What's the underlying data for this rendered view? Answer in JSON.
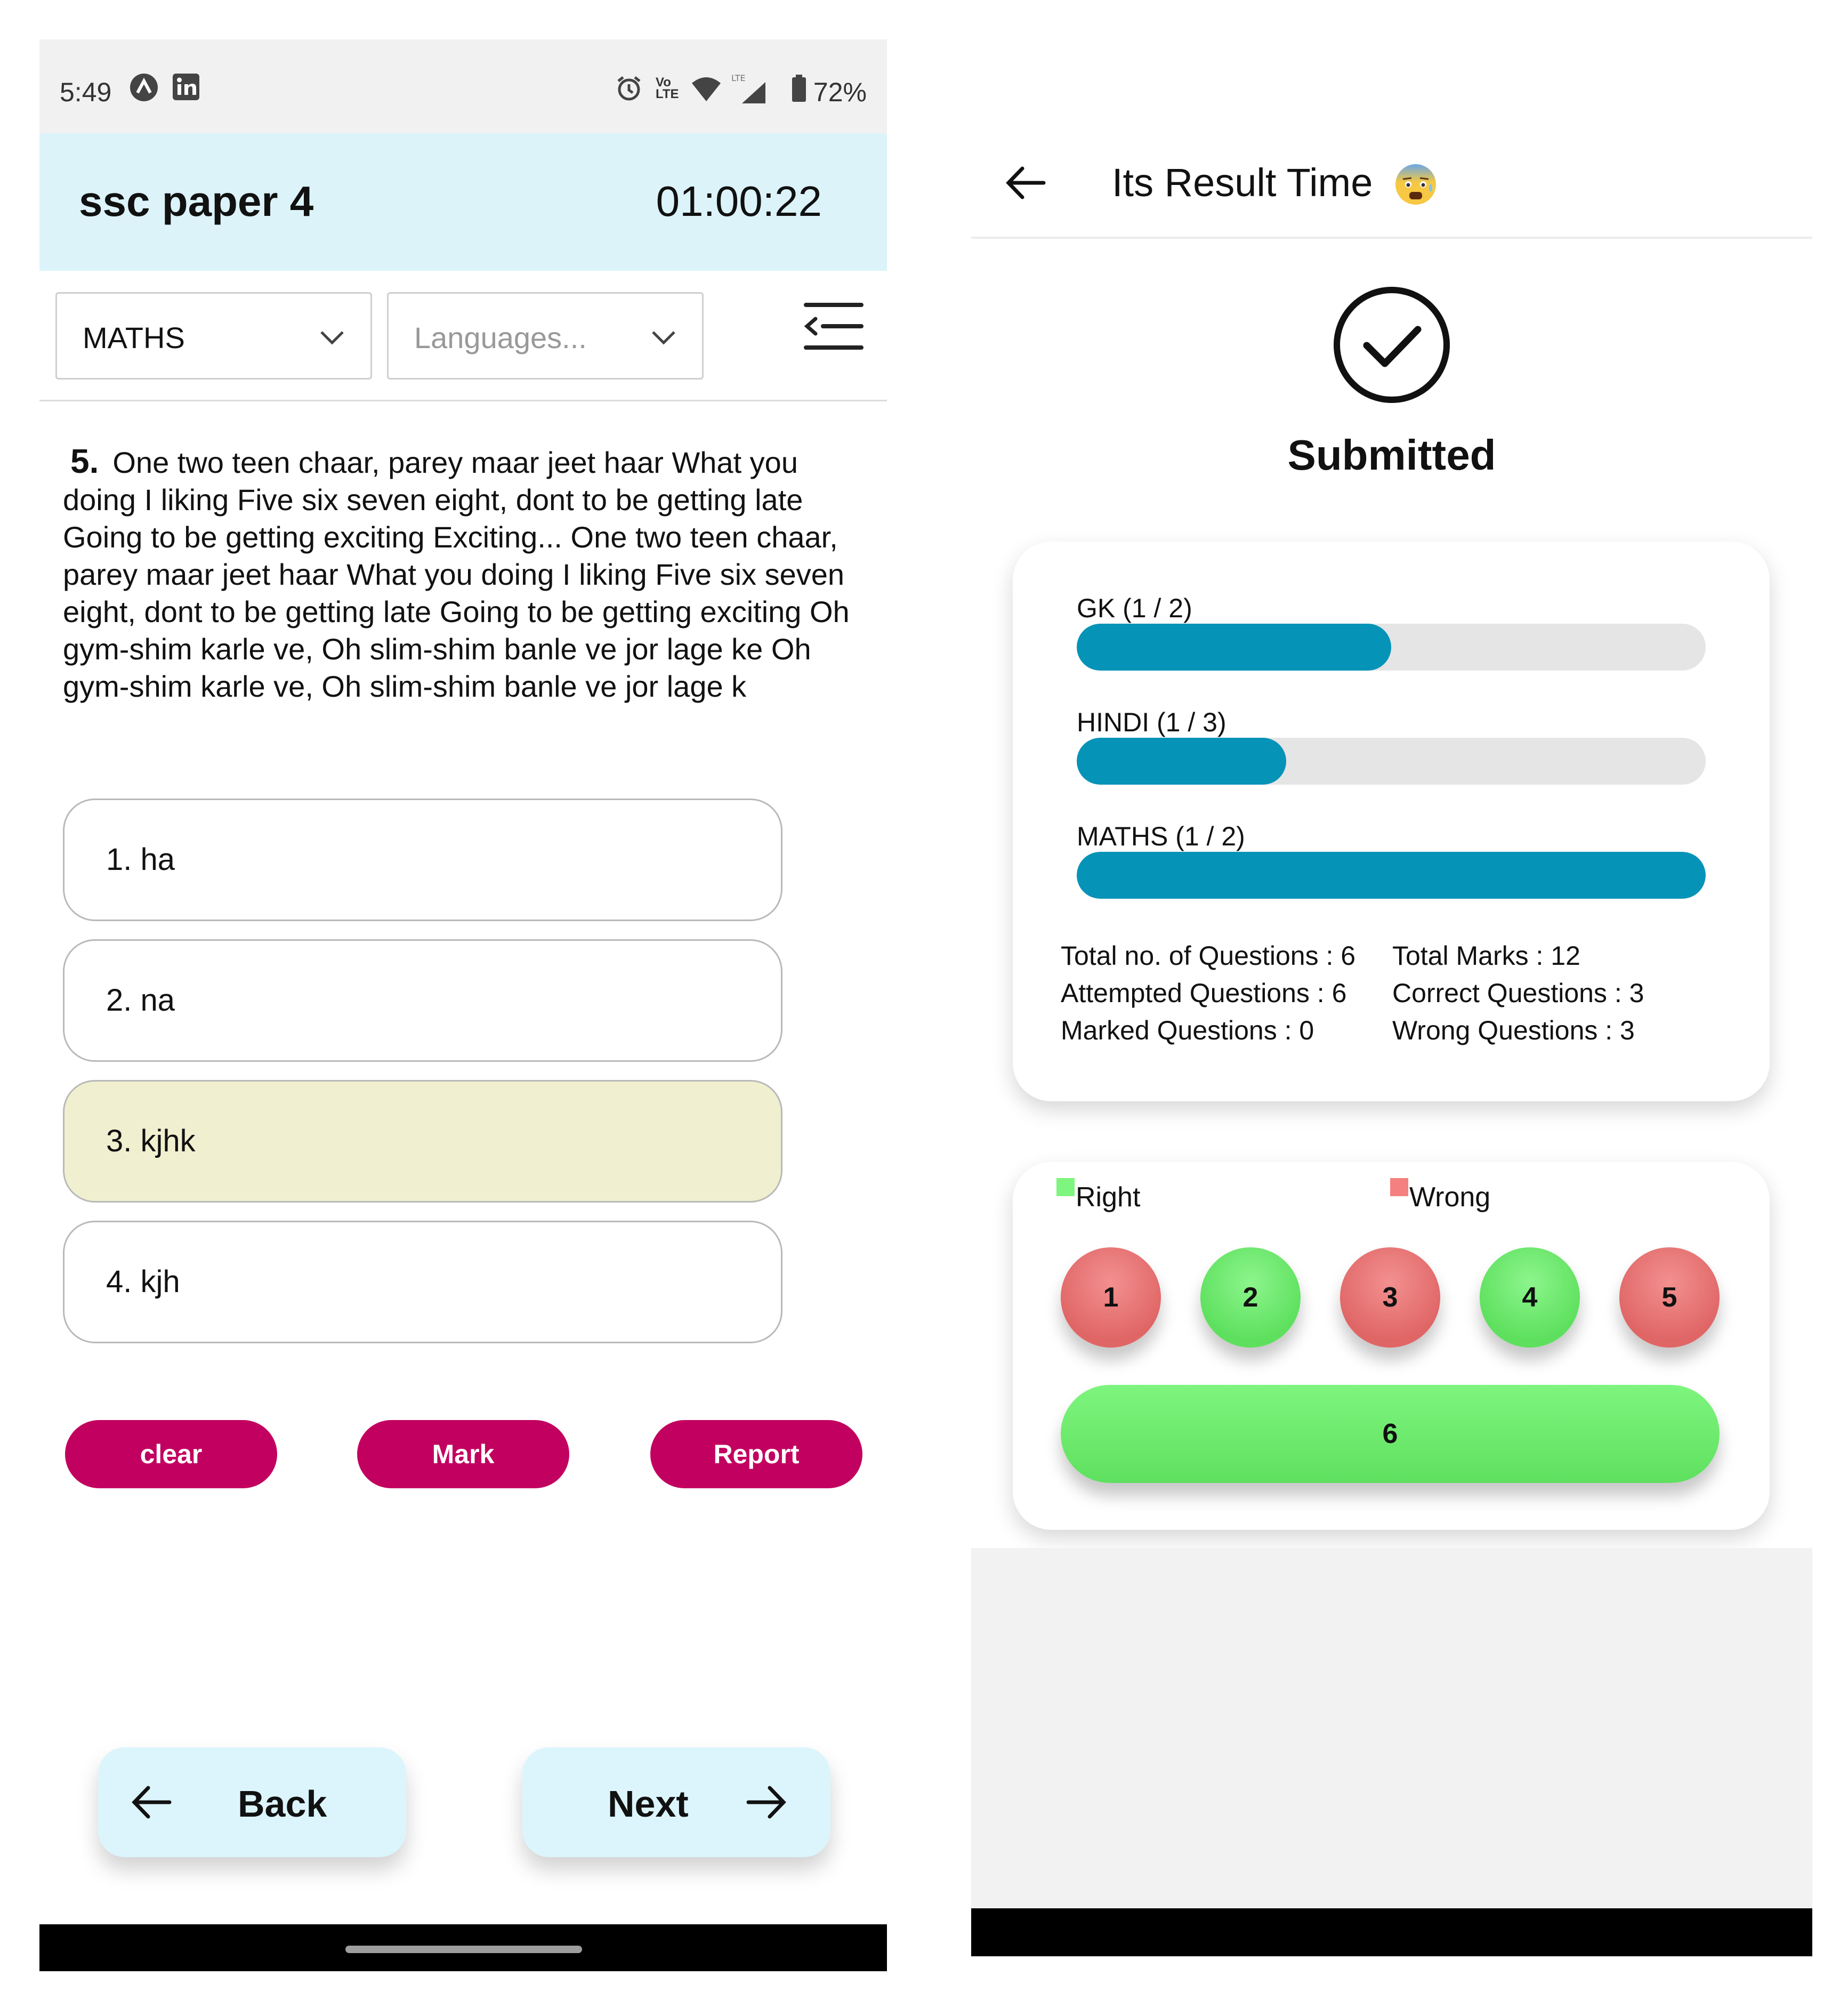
{
  "left": {
    "status": {
      "time": "5:49",
      "battery": "72%"
    },
    "header": {
      "title": "ssc paper 4",
      "timer": "01:00:22"
    },
    "subject_dropdown": "MATHS",
    "language_dropdown_placeholder": "Languages...",
    "question": {
      "number": "5.",
      "text": "One two teen chaar, parey maar jeet haar What you doing I liking Five six seven eight, dont to be getting late Going to be getting exciting Exciting... One two teen chaar, parey maar jeet haar What you doing I liking Five six seven eight, dont to be getting late Going to be getting exciting Oh gym-shim karle ve, Oh slim-shim banle ve jor lage ke Oh gym-shim karle ve, Oh slim-shim banle ve jor lage k"
    },
    "options": [
      {
        "label": "1. ha",
        "selected": false
      },
      {
        "label": "2. na",
        "selected": false
      },
      {
        "label": "3. kjhk",
        "selected": true
      },
      {
        "label": "4. kjh",
        "selected": false
      }
    ],
    "actions": {
      "clear": "clear",
      "mark": "Mark",
      "report": "Report"
    },
    "nav": {
      "back": "Back",
      "next": "Next"
    },
    "colors": {
      "header_bg": "#dcf3fa",
      "action_pill": "#c2005f",
      "selected_option": "#f0f0d0"
    }
  },
  "right": {
    "header": {
      "title": "Its Result Time",
      "emoji_icon": "anxious-face-emoji-icon"
    },
    "submitted": "Submitted",
    "sections": [
      {
        "label": "GK (1 / 2)",
        "fraction": 0.5
      },
      {
        "label": "HINDI (1 / 3)",
        "fraction": 0.333
      },
      {
        "label": "MATHS (1 / 2)",
        "fraction": 1.0
      }
    ],
    "stats": {
      "total_questions": "Total no. of Questions : 6",
      "attempted": "Attempted Questions : 6",
      "marked": "Marked Questions : 0",
      "total_marks": "Total Marks : 12",
      "correct": "Correct Questions : 3",
      "wrong": "Wrong Questions : 3"
    },
    "legend": {
      "right": "Right",
      "wrong": "Wrong"
    },
    "question_results": [
      {
        "number": "1",
        "status": "wrong"
      },
      {
        "number": "2",
        "status": "right"
      },
      {
        "number": "3",
        "status": "wrong"
      },
      {
        "number": "4",
        "status": "right"
      },
      {
        "number": "5",
        "status": "wrong"
      },
      {
        "number": "6",
        "status": "right"
      }
    ],
    "colors": {
      "progress": "#0693b8",
      "right": "#5ee05e",
      "wrong": "#e06666"
    }
  }
}
